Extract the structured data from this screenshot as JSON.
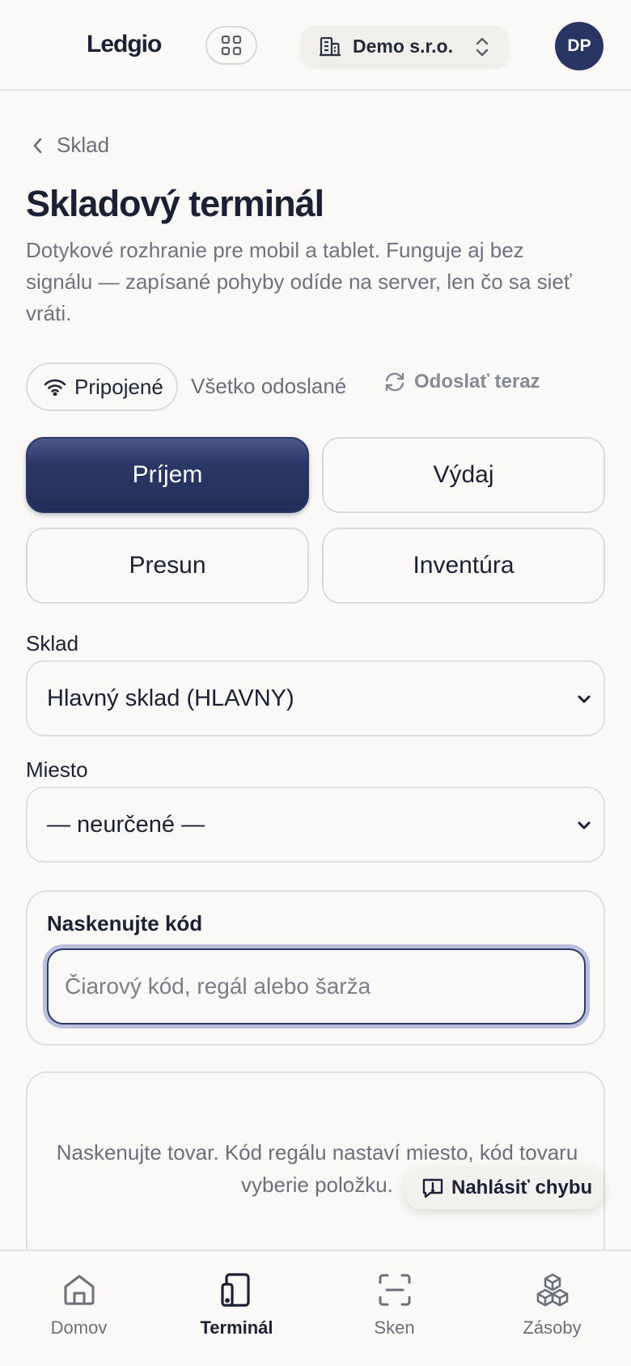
{
  "header": {
    "brand": "Ledgio",
    "company": "Demo s.r.o.",
    "avatar": "DP"
  },
  "breadcrumb": {
    "back_label": "Sklad"
  },
  "page": {
    "title": "Skladový terminál",
    "description": "Dotykové rozhranie pre mobil a tablet. Funguje aj bez signálu — zapísané pohyby odíde na server, len čo sa sieť vráti."
  },
  "status": {
    "connection": "Pripojené",
    "sync": "Všetko odoslané",
    "send_now": "Odoslať teraz"
  },
  "modes": [
    {
      "label": "Príjem",
      "active": true
    },
    {
      "label": "Výdaj",
      "active": false
    },
    {
      "label": "Presun",
      "active": false
    },
    {
      "label": "Inventúra",
      "active": false
    }
  ],
  "warehouse": {
    "label": "Sklad",
    "value": "Hlavný sklad (HLAVNY)"
  },
  "location": {
    "label": "Miesto",
    "value": "— neurčené —"
  },
  "scan": {
    "label": "Naskenujte kód",
    "placeholder": "Čiarový kód, regál alebo šarža",
    "value": ""
  },
  "empty_state": {
    "message": "Naskenujte tovar. Kód regálu nastaví miesto, kód tovaru vyberie položku."
  },
  "report_button": "Nahlásiť chybu",
  "bottom_nav": [
    {
      "label": "Domov",
      "icon": "home-icon",
      "active": false
    },
    {
      "label": "Terminál",
      "icon": "tablet-icon",
      "active": true
    },
    {
      "label": "Sken",
      "icon": "scan-icon",
      "active": false
    },
    {
      "label": "Zásoby",
      "icon": "boxes-icon",
      "active": false
    }
  ],
  "colors": {
    "background": "#faf9f7",
    "primary": "#283562",
    "text": "#1b2035",
    "muted": "#6b6f7a",
    "focus_ring": "#b9c0dd"
  }
}
